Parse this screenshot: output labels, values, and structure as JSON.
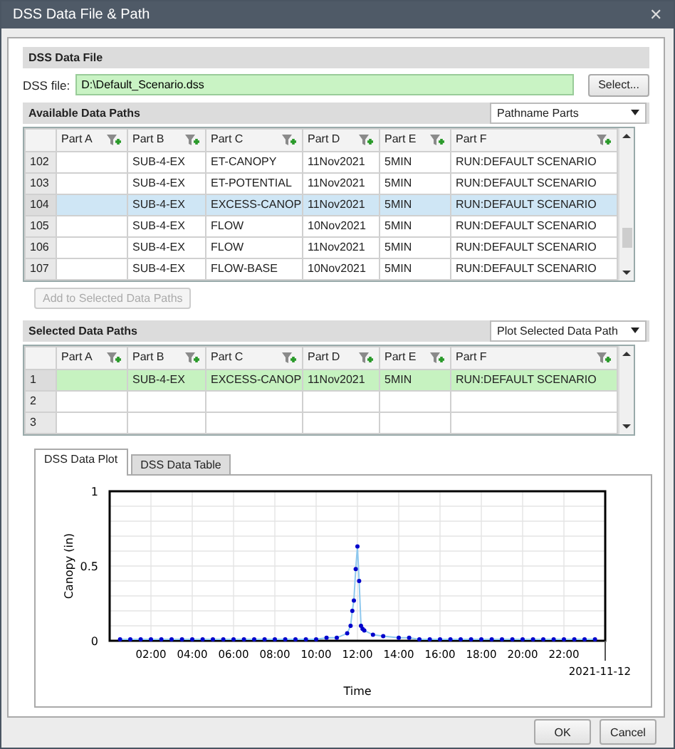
{
  "window": {
    "title": "DSS Data File & Path",
    "close": "✕"
  },
  "dss_file_section": {
    "title": "DSS Data File",
    "label": "DSS file:",
    "value": "D:\\Default_Scenario.dss",
    "button": "Select..."
  },
  "available_paths": {
    "title": "Available Data Paths",
    "dropdown": "Pathname Parts",
    "columns": [
      "Part A",
      "Part B",
      "Part C",
      "Part D",
      "Part E",
      "Part F"
    ],
    "rows": [
      {
        "number": "102",
        "cells": [
          null,
          "SUB-4-EX",
          "ET-CANOPY",
          "11Nov2021",
          "5MIN",
          "RUN:DEFAULT SCENARIO"
        ],
        "selected": false
      },
      {
        "number": "103",
        "cells": [
          null,
          "SUB-4-EX",
          "ET-POTENTIAL",
          "11Nov2021",
          "5MIN",
          "RUN:DEFAULT SCENARIO"
        ],
        "selected": false
      },
      {
        "number": "104",
        "cells": [
          null,
          "SUB-4-EX",
          "EXCESS-CANOP",
          "11Nov2021",
          "5MIN",
          "RUN:DEFAULT SCENARIO"
        ],
        "selected": true
      },
      {
        "number": "105",
        "cells": [
          null,
          "SUB-4-EX",
          "FLOW",
          "10Nov2021",
          "5MIN",
          "RUN:DEFAULT SCENARIO"
        ],
        "selected": false
      },
      {
        "number": "106",
        "cells": [
          null,
          "SUB-4-EX",
          "FLOW",
          "11Nov2021",
          "5MIN",
          "RUN:DEFAULT SCENARIO"
        ],
        "selected": false
      },
      {
        "number": "107",
        "cells": [
          null,
          "SUB-4-EX",
          "FLOW-BASE",
          "10Nov2021",
          "5MIN",
          "RUN:DEFAULT SCENARIO"
        ],
        "selected": false
      }
    ]
  },
  "add_button": {
    "label": "Add to Selected Data Paths",
    "disabled": true
  },
  "selected_paths": {
    "title": "Selected Data Paths",
    "dropdown": "Plot Selected Data Path",
    "columns": [
      "Part A",
      "Part B",
      "Part C",
      "Part D",
      "Part E",
      "Part F"
    ],
    "rows": [
      {
        "number": "1",
        "cells": [
          null,
          "SUB-4-EX",
          "EXCESS-CANOP",
          "11Nov2021",
          "5MIN",
          "RUN:DEFAULT SCENARIO"
        ],
        "selected": true
      },
      {
        "number": "2",
        "cells": [
          null,
          null,
          null,
          null,
          null,
          null
        ],
        "selected": false
      },
      {
        "number": "3",
        "cells": [
          null,
          null,
          null,
          null,
          null,
          null
        ],
        "selected": false
      }
    ]
  },
  "tabs": [
    {
      "label": "DSS Data Plot",
      "selected": true
    },
    {
      "label": "DSS Data Table",
      "selected": false
    }
  ],
  "plot": {
    "chart_data": {
      "type": "line",
      "xlabel": "Time",
      "ylabel": "Canopy (in)",
      "x": [
        0.5,
        1,
        1.5,
        2,
        2.5,
        3,
        3.5,
        4,
        4.5,
        5,
        5.5,
        6,
        6.5,
        7,
        7.5,
        8,
        8.5,
        9,
        9.5,
        10,
        10.5,
        11,
        11.5,
        11.67,
        11.75,
        11.83,
        11.92,
        12,
        12.08,
        12.17,
        12.25,
        12.33,
        12.75,
        13.25,
        14,
        14.5,
        15,
        15.5,
        16,
        16.5,
        17,
        17.5,
        18,
        18.5,
        19,
        19.5,
        20,
        20.5,
        21,
        21.5,
        22,
        22.5,
        23,
        23.5
      ],
      "series": [
        {
          "color": "#0000cc",
          "marker": "circle",
          "values": [
            0.01,
            0.01,
            0.01,
            0.01,
            0.01,
            0.01,
            0.01,
            0.01,
            0.01,
            0.01,
            0.01,
            0.01,
            0.01,
            0.01,
            0.01,
            0.01,
            0.01,
            0.01,
            0.01,
            0.01,
            0.02,
            0.02,
            0.05,
            0.1,
            0.2,
            0.27,
            0.48,
            0.63,
            0.4,
            0.1,
            0.08,
            0.07,
            0.04,
            0.03,
            0.02,
            0.02,
            0.01,
            0.01,
            0.01,
            0.01,
            0.01,
            0.01,
            0.01,
            0.01,
            0.01,
            0.01,
            0.01,
            0.01,
            0.01,
            0.01,
            0.01,
            0.01,
            0.01,
            0.01
          ]
        }
      ],
      "xlim": [
        0,
        24
      ],
      "ylim": [
        0,
        1
      ],
      "xticks": [
        {
          "value": 2,
          "label": "02:00"
        },
        {
          "value": 4,
          "label": "04:00"
        },
        {
          "value": 6,
          "label": "06:00"
        },
        {
          "value": 8,
          "label": "08:00"
        },
        {
          "value": 10,
          "label": "10:00"
        },
        {
          "value": 12,
          "label": "12:00"
        },
        {
          "value": 14,
          "label": "14:00"
        },
        {
          "value": 16,
          "label": "16:00"
        },
        {
          "value": 18,
          "label": "18:00"
        },
        {
          "value": 20,
          "label": "20:00"
        },
        {
          "value": 22,
          "label": "22:00"
        }
      ],
      "yticks": [
        0,
        0.5,
        1
      ],
      "grid": true,
      "annotations": [
        "2021-11-12"
      ]
    }
  },
  "footer_buttons": [
    "OK",
    "Cancel"
  ]
}
